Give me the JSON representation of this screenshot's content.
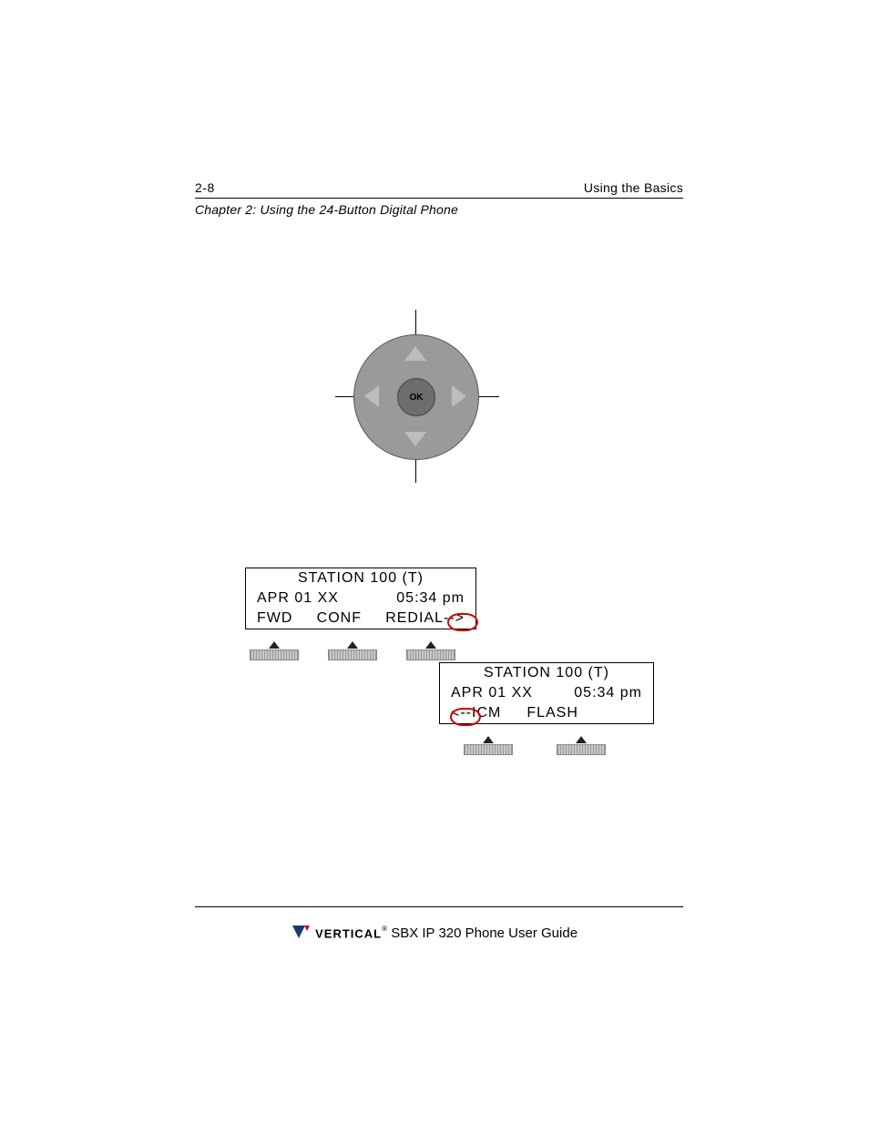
{
  "header": {
    "page_number": "2-8",
    "section": "Using the Basics",
    "chapter": "Chapter 2: Using the 24-Button Digital Phone"
  },
  "nav_button": {
    "center_label": "OK"
  },
  "lcd1": {
    "line1": "STATION 100 (T)",
    "line2_left": "APR 01 XX",
    "line2_right": "05:34 pm",
    "line3_a": "FWD",
    "line3_b": "CONF",
    "line3_c": "REDIAL",
    "line3_arrow": "-->"
  },
  "lcd2": {
    "line1": "STATION 100 (T)",
    "line2_left": "APR 01 XX",
    "line2_right": "05:34 pm",
    "line3_arrow": "<--",
    "line3_a": "ICM",
    "line3_b": "FLASH"
  },
  "footer": {
    "logo_brand": "VERTICAL",
    "guide_title": " SBX IP 320 Phone User Guide"
  }
}
